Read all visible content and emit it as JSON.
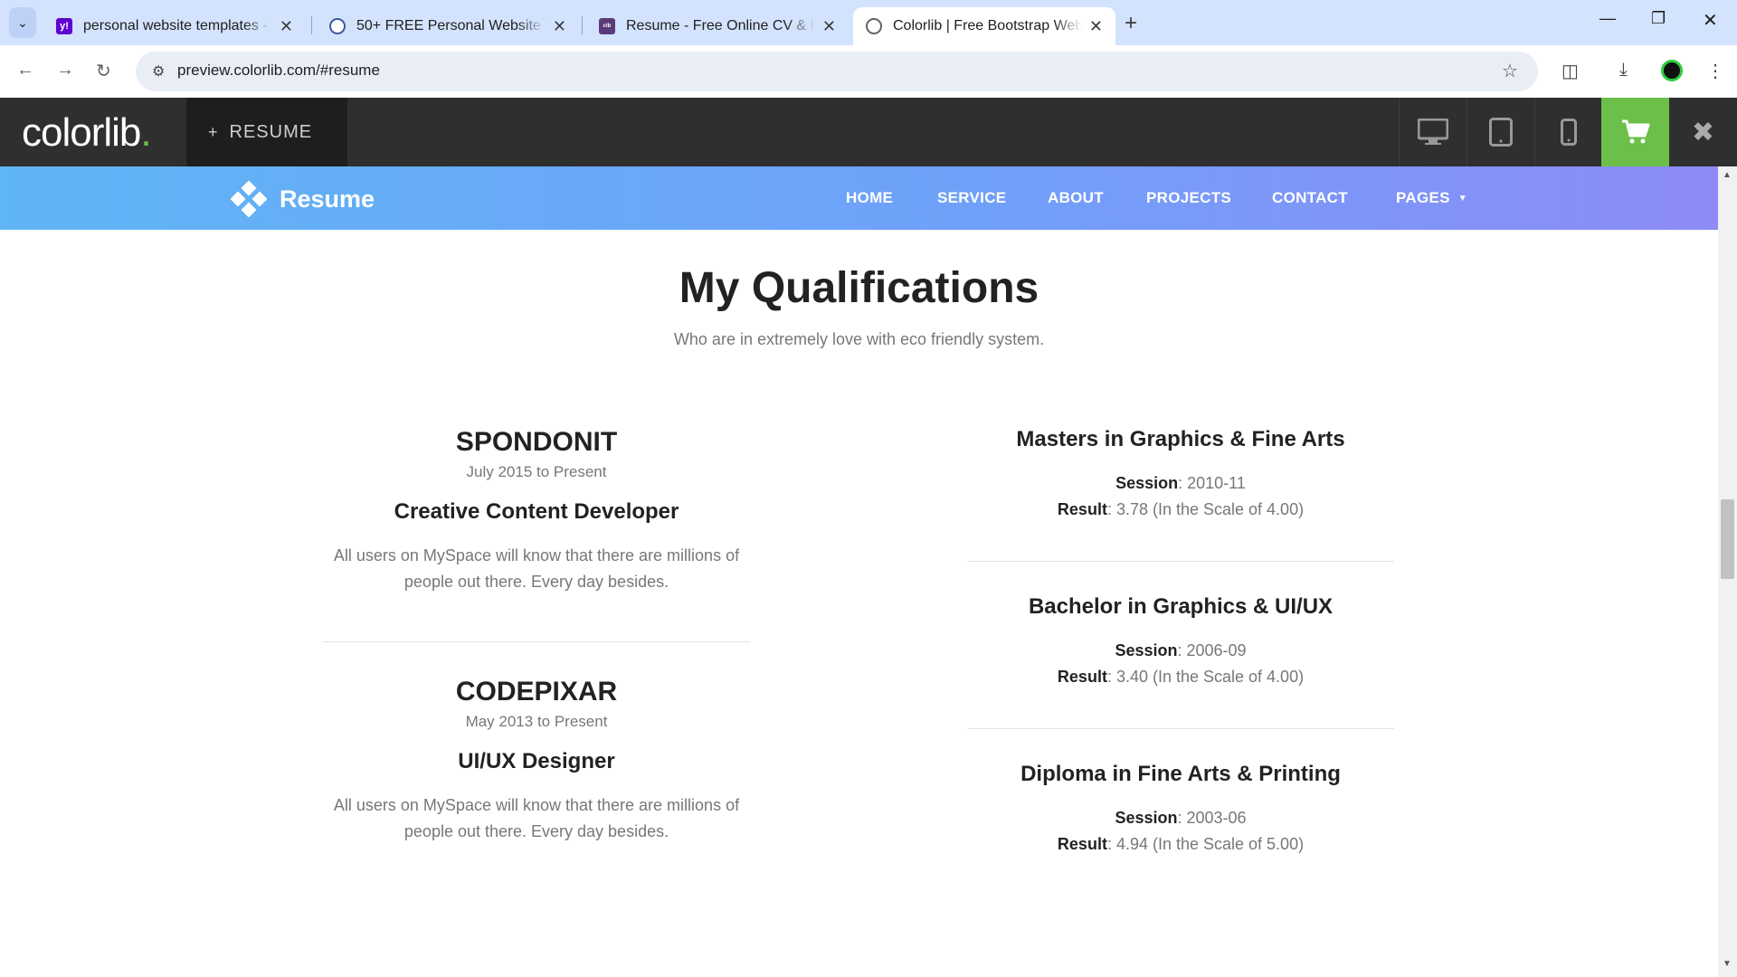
{
  "browser": {
    "tabs": [
      {
        "title": "personal website templates - Ya",
        "favicon": "yahoo-icon",
        "active": false
      },
      {
        "title": "50+ FREE Personal Website Tem",
        "favicon": "site-icon",
        "active": false
      },
      {
        "title": "Resume - Free Online CV & Res",
        "favicon": "colorlib-icon",
        "active": false
      },
      {
        "title": "Colorlib | Free Bootstrap Websit",
        "favicon": "globe-icon",
        "active": true
      }
    ],
    "url": "preview.colorlib.com/#resume"
  },
  "colorlib_bar": {
    "logo": "colorlib",
    "logo_dot": ".",
    "theme_label": "RESUME",
    "theme_plus": "+",
    "accent": "#6cc04a"
  },
  "site": {
    "brand": "Resume",
    "nav": [
      "HOME",
      "SERVICE",
      "ABOUT",
      "PROJECTS",
      "CONTACT",
      "PAGES"
    ]
  },
  "section": {
    "title": "My Qualifications",
    "subtitle": "Who are in extremely love with eco friendly system."
  },
  "experience": [
    {
      "company": "SPONDONIT",
      "period": "July 2015 to Present",
      "role": "Creative Content Developer",
      "description": "All users on MySpace will know that there are millions of people out there. Every day besides."
    },
    {
      "company": "CODEPIXAR",
      "period": "May 2013 to Present",
      "role": "UI/UX Designer",
      "description": "All users on MySpace will know that there are millions of people out there. Every day besides."
    }
  ],
  "education": [
    {
      "degree": "Masters in Graphics & Fine Arts",
      "session_label": "Session",
      "session": ": 2010-11",
      "result_label": "Result",
      "result": ": 3.78 (In the Scale of 4.00)"
    },
    {
      "degree": "Bachelor in Graphics & UI/UX",
      "session_label": "Session",
      "session": ": 2006-09",
      "result_label": "Result",
      "result": ": 3.40 (In the Scale of 4.00)"
    },
    {
      "degree": "Diploma in Fine Arts & Printing",
      "session_label": "Session",
      "session": ": 2003-06",
      "result_label": "Result",
      "result": ": 4.94 (In the Scale of 5.00)"
    }
  ]
}
